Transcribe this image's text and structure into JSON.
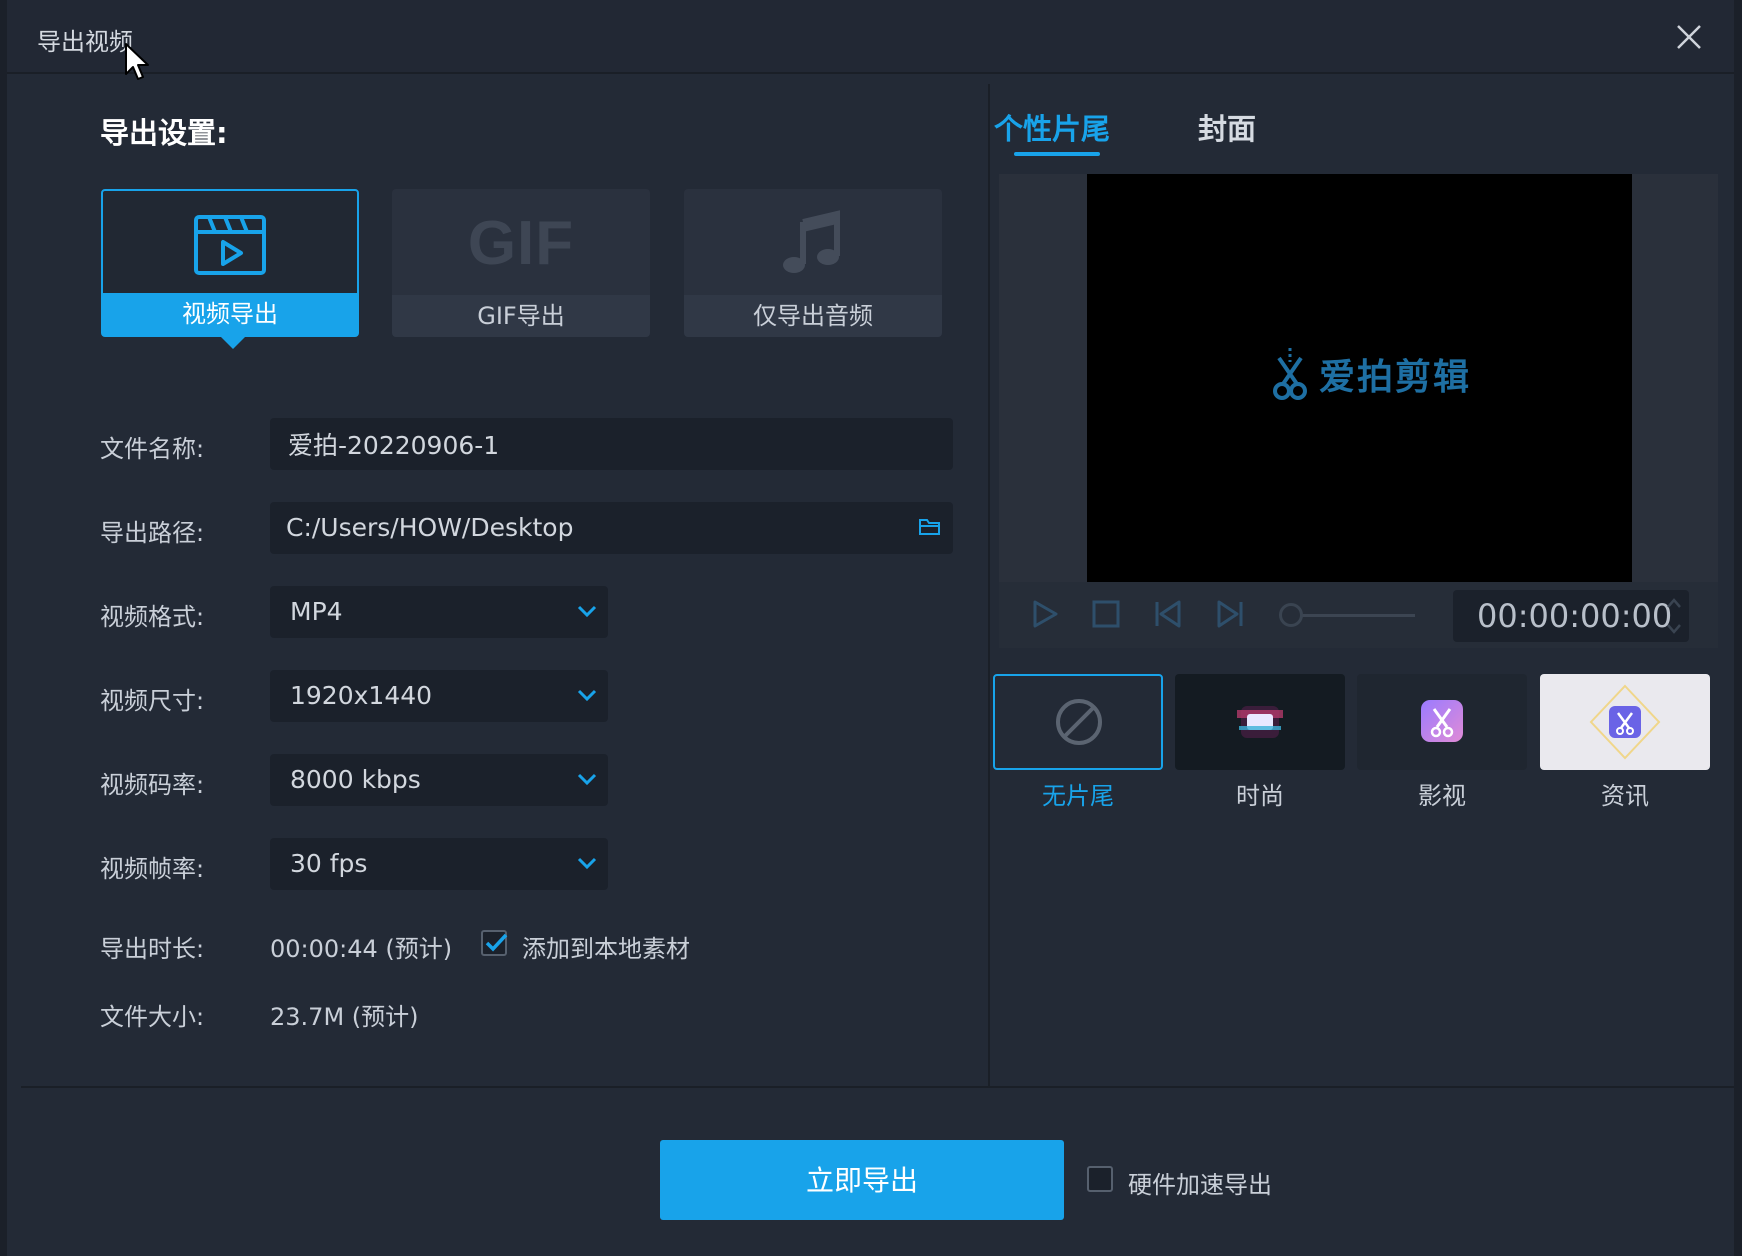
{
  "dialog": {
    "title": "导出视频"
  },
  "settings": {
    "title": "导出设置:",
    "export_types": [
      {
        "label": "视频导出",
        "icon": "video-clapper-icon",
        "active": true
      },
      {
        "label": "GIF导出",
        "icon_text": "GIF",
        "active": false
      },
      {
        "label": "仅导出音频",
        "icon": "music-note-icon",
        "active": false
      }
    ],
    "fields": {
      "file_name": {
        "label": "文件名称:",
        "value": "爱拍-20220906-1"
      },
      "export_path": {
        "label": "导出路径:",
        "value": "C:/Users/HOW/Desktop"
      },
      "format": {
        "label": "视频格式:",
        "value": "MP4"
      },
      "size": {
        "label": "视频尺寸:",
        "value": "1920x1440"
      },
      "bitrate": {
        "label": "视频码率:",
        "value": "8000 kbps"
      },
      "framerate": {
        "label": "视频帧率:",
        "value": "30 fps"
      },
      "duration": {
        "label": "导出时长:",
        "value": "00:00:44 (预计)"
      },
      "filesize": {
        "label": "文件大小:",
        "value": "23.7M (预计)"
      }
    },
    "add_to_local": {
      "label": "添加到本地素材",
      "checked": true
    }
  },
  "right_panel": {
    "tabs": [
      {
        "label": "个性片尾",
        "active": true
      },
      {
        "label": "封面",
        "active": false
      }
    ],
    "preview": {
      "watermark": "爱拍剪辑"
    },
    "player": {
      "timecode": "00:00:00:00"
    },
    "endings": [
      {
        "label": "无片尾",
        "active": true
      },
      {
        "label": "时尚",
        "active": false
      },
      {
        "label": "影视",
        "active": false
      },
      {
        "label": "资讯",
        "active": false
      }
    ]
  },
  "footer": {
    "export_button": "立即导出",
    "hardware_accel": {
      "label": "硬件加速导出",
      "checked": false
    }
  },
  "colors": {
    "accent": "#18a3ea",
    "background": "#232a36",
    "field": "#1b212b"
  }
}
